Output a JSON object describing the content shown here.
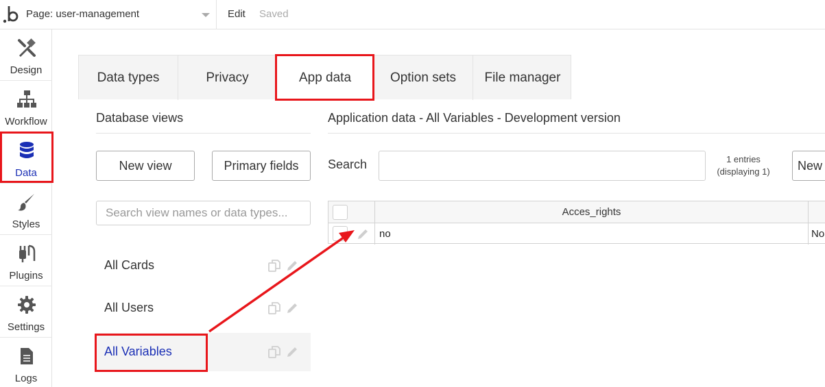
{
  "topbar": {
    "logo_text": "b",
    "page_select": "Page: user-management",
    "edit_label": "Edit",
    "status": "Saved"
  },
  "sidebar": {
    "items": [
      {
        "label": "Design",
        "icon": "design-icon"
      },
      {
        "label": "Workflow",
        "icon": "workflow-icon"
      },
      {
        "label": "Data",
        "icon": "database-icon",
        "active": true
      },
      {
        "label": "Styles",
        "icon": "brush-icon"
      },
      {
        "label": "Plugins",
        "icon": "plug-icon"
      },
      {
        "label": "Settings",
        "icon": "gear-icon"
      },
      {
        "label": "Logs",
        "icon": "document-icon"
      }
    ]
  },
  "tabs": [
    {
      "label": "Data types"
    },
    {
      "label": "Privacy"
    },
    {
      "label": "App data",
      "active": true
    },
    {
      "label": "Option sets"
    },
    {
      "label": "File manager"
    }
  ],
  "views": {
    "title": "Database views",
    "new_view_label": "New view",
    "primary_fields_label": "Primary fields",
    "search_placeholder": "Search view names or data types...",
    "items": [
      {
        "label": "All Cards"
      },
      {
        "label": "All Users"
      },
      {
        "label": "All Variables",
        "selected": true
      }
    ]
  },
  "app_data": {
    "title": "Application data - All Variables - Development version",
    "search_label": "Search",
    "search_value": "",
    "entries_count": "1 entries",
    "entries_displaying": "(displaying 1)",
    "new_entry_label": "New",
    "columns": [
      "Acces_rights"
    ],
    "rows": [
      {
        "acces_rights": "no",
        "next_col": "No"
      }
    ]
  },
  "colors": {
    "highlight": "#e8161b",
    "active_blue": "#1a2fb5"
  }
}
